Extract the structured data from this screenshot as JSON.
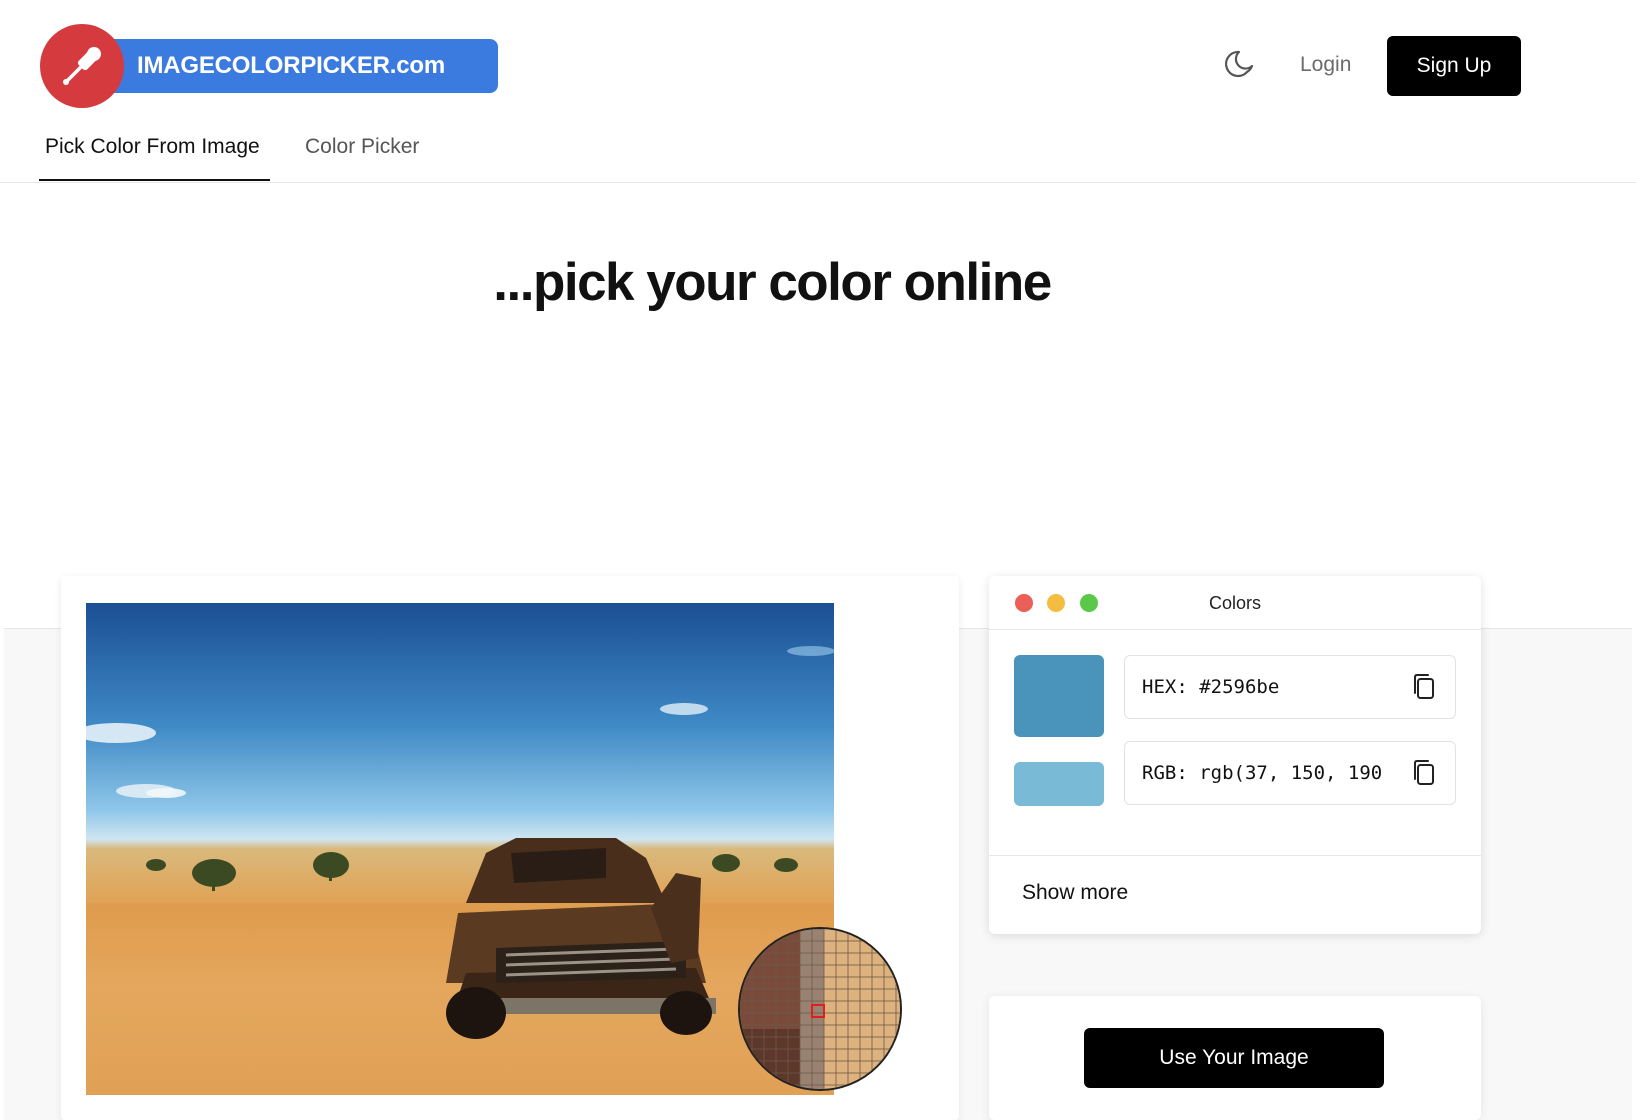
{
  "brand": {
    "name": "IMAGECOLORPICKER.com",
    "accent": "#3b7be0",
    "logo_color": "#d53a3e"
  },
  "header": {
    "theme_toggle_icon": "moon-icon",
    "login_label": "Login",
    "signup_label": "Sign Up"
  },
  "tabs": [
    {
      "label": "Pick Color From Image",
      "active": true
    },
    {
      "label": "Color Picker",
      "active": false
    }
  ],
  "hero": {
    "title": "...pick your color online"
  },
  "colors_panel": {
    "title": "Colors",
    "window_dots": [
      "#ec5f57",
      "#f5bd3f",
      "#5cc84a"
    ],
    "main_swatch": "#4a94bc",
    "secondary_swatch": "#79bad6",
    "hex_label": "HEX: #2596be",
    "rgb_label": "RGB: rgb(37, 150, 190",
    "copy_icon": "copy-icon",
    "show_more_label": "Show more"
  },
  "actions": {
    "use_image_label": "Use Your Image"
  }
}
